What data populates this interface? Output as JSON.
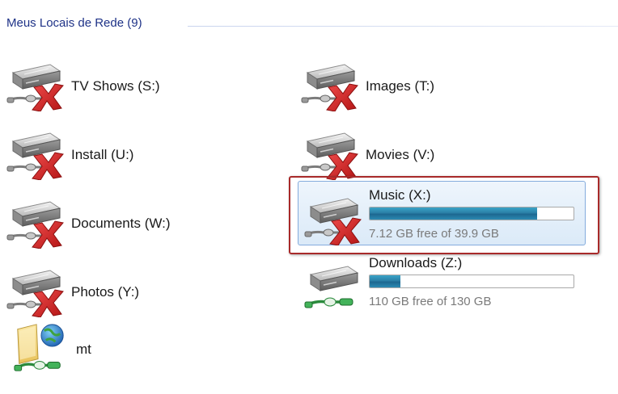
{
  "group": {
    "title": "Meus Locais de Rede (9)"
  },
  "drives": [
    {
      "name": "TV Shows (S:)",
      "icon": "disconnected-network-drive-icon"
    },
    {
      "name": "Images (T:)",
      "icon": "disconnected-network-drive-icon"
    },
    {
      "name": "Install (U:)",
      "icon": "disconnected-network-drive-icon"
    },
    {
      "name": "Movies (V:)",
      "icon": "disconnected-network-drive-icon"
    },
    {
      "name": "Documents (W:)",
      "icon": "disconnected-network-drive-icon"
    },
    {
      "name": "Music (X:)",
      "icon": "disconnected-network-drive-icon",
      "free_text": "7.12 GB free of 39.9 GB",
      "used_fraction": 0.82,
      "selected": true,
      "annotated": true
    },
    {
      "name": "Photos (Y:)",
      "icon": "disconnected-network-drive-icon"
    },
    {
      "name": "Downloads (Z:)",
      "icon": "connected-network-drive-icon",
      "free_text": "110 GB free of 130 GB",
      "used_fraction": 0.15
    },
    {
      "name": "mt",
      "icon": "network-folder-globe-icon"
    }
  ],
  "colors": {
    "group_title": "#1e3287",
    "capacity_fill": "#1d6790",
    "disconnected_x": "#d8262a",
    "connected_cable": "#2aa34a",
    "annotation_border": "#a82a2a",
    "selection_border": "#84acdd"
  }
}
